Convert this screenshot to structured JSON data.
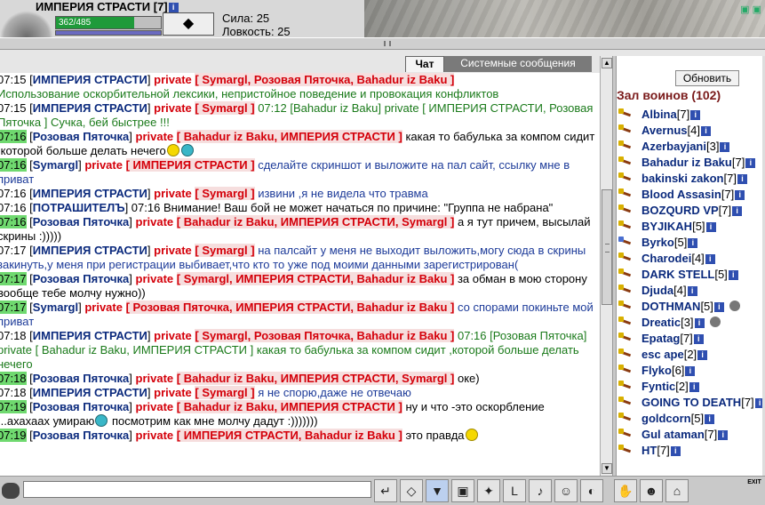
{
  "header": {
    "char_name": "ИМПЕРИЯ СТРАСТИ",
    "char_level": "[7]",
    "hp_text": "362/485",
    "hp_fraction": 0.746,
    "stats": [
      {
        "label": "Сила: 25"
      },
      {
        "label": "Ловкость: 25"
      }
    ]
  },
  "tabs": [
    {
      "label": "Чат",
      "active": true
    },
    {
      "label": "Системные сообщения",
      "active": false
    }
  ],
  "chat": [
    {
      "time": "07:15",
      "hl": false,
      "name": "ИМПЕРИЯ СТРАСТИ",
      "private": "Symargl, Розовая Пяточка, Bahadur iz Baku",
      "text": "",
      "text_color": "tx"
    },
    {
      "time": "",
      "hl": false,
      "name": "",
      "private": "",
      "text": "Использование оскорбительной лексики, непристойное поведение и провокация конфликтов",
      "text_color": "gr"
    },
    {
      "time": "07:15",
      "hl": false,
      "name": "ИМПЕРИЯ СТРАСТИ",
      "private": "Symargl",
      "text": "07:12 [Bahadur iz Baku] private [ ИМПЕРИЯ СТРАСТИ, Розовая Пяточка ] Сучка, бей быстрее !!!",
      "text_color": "gr"
    },
    {
      "time": "07:16",
      "hl": true,
      "name": "Розовая Пяточка",
      "private": "Bahadur iz Baku, ИМПЕРИЯ СТРАСТИ",
      "text": "какая то бабулька за компом сидит ,которой больше делать нечего",
      "text_color": "sys",
      "emo": [
        "y",
        "b"
      ]
    },
    {
      "time": "07:16",
      "hl": true,
      "name": "Symargl",
      "private": "ИМПЕРИЯ СТРАСТИ",
      "text": "сделайте скриншот и выложите на пал сайт, ссылку мне в приват",
      "text_color": "tx"
    },
    {
      "time": "07:16",
      "hl": false,
      "name": "ИМПЕРИЯ СТРАСТИ",
      "private": "Symargl",
      "text": "извини ,я не видела что травма",
      "text_color": "tx"
    },
    {
      "time": "07:16",
      "hl": false,
      "name": "ПОТРАШИТЕЛЪ",
      "private": "",
      "text": "07:16 Внимание! Ваш бой не может начаться по причине: \"Группа не набрана\"",
      "text_color": "sys"
    },
    {
      "time": "07:16",
      "hl": true,
      "name": "Розовая Пяточка",
      "private": "Bahadur iz Baku, ИМПЕРИЯ СТРАСТИ, Symargl",
      "text": "а я тут причем, высылай скрины :)))))",
      "text_color": "sys"
    },
    {
      "time": "07:17",
      "hl": false,
      "name": "ИМПЕРИЯ СТРАСТИ",
      "private": "Symargl",
      "text": "на палсайт у меня не выходит выложить,могу сюда в скрины закинуть,у меня при регистрации выбивает,что кто то уже под моими данными зарегистрирован(",
      "text_color": "tx"
    },
    {
      "time": "07:17",
      "hl": true,
      "name": "Розовая Пяточка",
      "private": "Symargl, ИМПЕРИЯ СТРАСТИ, Bahadur iz Baku",
      "text": "за обман в мою сторону вообще тебе молчу нужно))",
      "text_color": "sys"
    },
    {
      "time": "07:17",
      "hl": true,
      "name": "Symargl",
      "private": "Розовая Пяточка, ИМПЕРИЯ СТРАСТИ, Bahadur iz Baku",
      "text": "со спорами покиньте мой приват",
      "text_color": "tx"
    },
    {
      "time": "07:18",
      "hl": false,
      "name": "ИМПЕРИЯ СТРАСТИ",
      "private": "Symargl, Розовая Пяточка, Bahadur iz Baku",
      "text": "07:16 [Розовая Пяточка] private [ Bahadur iz Baku, ИМПЕРИЯ СТРАСТИ ] какая то бабулька за компом сидит ,которой больше делать нечего",
      "text_color": "gr"
    },
    {
      "time": "07:18",
      "hl": true,
      "name": "Розовая Пяточка",
      "private": "Bahadur iz Baku, ИМПЕРИЯ СТРАСТИ, Symargl",
      "text": "оке)",
      "text_color": "sys"
    },
    {
      "time": "07:18",
      "hl": false,
      "name": "ИМПЕРИЯ СТРАСТИ",
      "private": "Symargl",
      "text": "я не спорю,даже не отвечаю",
      "text_color": "tx"
    },
    {
      "time": "07:19",
      "hl": true,
      "name": "Розовая Пяточка",
      "private": "Bahadur iz Baku, ИМПЕРИЯ СТРАСТИ",
      "text": "ну и что -это оскорбление ...ахахаах умираю",
      "text_color": "sys",
      "emo": [
        "b"
      ],
      "text2": "посмотрим как мне молчу дадут :)))))))"
    },
    {
      "time": "07:19",
      "hl": true,
      "name": "Розовая Пяточка",
      "private": "ИМПЕРИЯ СТРАСТИ, Bahadur iz Baku",
      "text": "это правда",
      "text_color": "sys",
      "emo": [
        "y"
      ]
    }
  ],
  "sidebar": {
    "refresh_label": "Обновить",
    "hall_title": "Зал воинов (102)",
    "players": [
      {
        "name": "Albina",
        "lvl": "[7]",
        "icon": "gold"
      },
      {
        "name": "Avernus",
        "lvl": "[4]",
        "icon": "gold"
      },
      {
        "name": "Azerbayjani",
        "lvl": "[3]",
        "icon": "gold"
      },
      {
        "name": "Bahadur iz Baku",
        "lvl": "[7]",
        "icon": "gold"
      },
      {
        "name": "bakinski zakon",
        "lvl": "[7]",
        "icon": "gold"
      },
      {
        "name": "Blood Assasin",
        "lvl": "[7]",
        "icon": "gold"
      },
      {
        "name": "BOZQURD VP",
        "lvl": "[7]",
        "icon": "gold"
      },
      {
        "name": "BYJIKAH",
        "lvl": "[5]",
        "icon": "gold"
      },
      {
        "name": "Byrko",
        "lvl": "[5]",
        "icon": "blue"
      },
      {
        "name": "Charodei",
        "lvl": "[4]",
        "icon": "gold"
      },
      {
        "name": "DARK STELL",
        "lvl": "[5]",
        "icon": "gold"
      },
      {
        "name": "Djuda",
        "lvl": "[4]",
        "icon": "gold"
      },
      {
        "name": "DOTHMAN",
        "lvl": "[5]",
        "icon": "gold",
        "extra": true
      },
      {
        "name": "Dreatic",
        "lvl": "[3]",
        "icon": "gold",
        "extra": true
      },
      {
        "name": "Epatag",
        "lvl": "[7]",
        "icon": "gold"
      },
      {
        "name": "esc ape",
        "lvl": "[2]",
        "icon": "gold"
      },
      {
        "name": "Flyko",
        "lvl": "[6]",
        "icon": "gold"
      },
      {
        "name": "Fyntic",
        "lvl": "[2]",
        "icon": "gold"
      },
      {
        "name": "GOING TO DEATH",
        "lvl": "[7]",
        "icon": "gold"
      },
      {
        "name": "goldcorn",
        "lvl": "[5]",
        "icon": "gold"
      },
      {
        "name": "Gul ataman",
        "lvl": "[7]",
        "icon": "gold"
      },
      {
        "name": "HT",
        "lvl": "[7]",
        "icon": "gold"
      }
    ]
  },
  "toolbar": {
    "buttons": [
      "enter-icon",
      "eraser-icon",
      "filter-icon",
      "save-icon",
      "walk-icon",
      "language-icon",
      "music-icon",
      "smiley-icon",
      "helmet-icon",
      "",
      "gesture-icon",
      "mask-icon",
      "lock-icon"
    ],
    "exit_label": "EXIT"
  }
}
